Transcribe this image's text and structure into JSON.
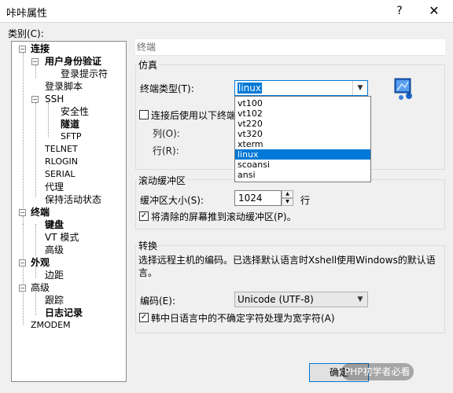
{
  "window": {
    "title": "咔咔属性",
    "help_glyph": "?",
    "close_glyph": "✕"
  },
  "category_label": "类别(C):",
  "tree": {
    "items": [
      {
        "label": "连接",
        "bold": true
      },
      {
        "label": "用户身份验证",
        "bold": true
      },
      {
        "label": "登录提示符",
        "bold": false
      },
      {
        "label": "登录脚本",
        "bold": false
      },
      {
        "label": "SSH",
        "bold": false
      },
      {
        "label": "安全性",
        "bold": false
      },
      {
        "label": "隧道",
        "bold": true
      },
      {
        "label": "SFTP",
        "bold": false
      },
      {
        "label": "TELNET",
        "bold": false
      },
      {
        "label": "RLOGIN",
        "bold": false
      },
      {
        "label": "SERIAL",
        "bold": false
      },
      {
        "label": "代理",
        "bold": false
      },
      {
        "label": "保持活动状态",
        "bold": false
      },
      {
        "label": "终端",
        "bold": true
      },
      {
        "label": "键盘",
        "bold": true
      },
      {
        "label": "VT 模式",
        "bold": false
      },
      {
        "label": "高级",
        "bold": false
      },
      {
        "label": "外观",
        "bold": true
      },
      {
        "label": "边距",
        "bold": false
      },
      {
        "label": "高级",
        "bold": false
      },
      {
        "label": "跟踪",
        "bold": false
      },
      {
        "label": "日志记录",
        "bold": true
      },
      {
        "label": "ZMODEM",
        "bold": false
      }
    ]
  },
  "panel": {
    "header": "终端",
    "emulation": {
      "group_title": "仿真",
      "terminal_type_label": "终端类型(T):",
      "terminal_type_value": "linux",
      "dropdown_options": [
        "vt100",
        "vt102",
        "vt220",
        "vt320",
        "xterm",
        "linux",
        "scoansi",
        "ansi"
      ],
      "dropdown_selected": "linux",
      "after_connect_checkbox_label": "连接后使用以下终端",
      "cols_label": "列(O):",
      "rows_label": "行(R):"
    },
    "scrollback": {
      "group_title": "滚动缓冲区",
      "buffer_size_label": "缓冲区大小(S):",
      "buffer_size_value": "1024",
      "buffer_size_unit": "行",
      "push_cleared_checkbox_label": "将清除的屏幕推到滚动缓冲区(P)。",
      "push_cleared_checked": true
    },
    "translation": {
      "group_title": "转换",
      "description": "选择远程主机的编码。已选择默认语言时Xshell使用Windows的默认语言。",
      "encoding_label": "编码(E):",
      "encoding_value": "Unicode (UTF-8)",
      "cjk_checkbox_label": "韩中日语言中的不确定字符处理为宽字符(A)",
      "cjk_checked": true
    }
  },
  "ok_button_label": "确定",
  "watermark_text": "PHP初学者必看"
}
